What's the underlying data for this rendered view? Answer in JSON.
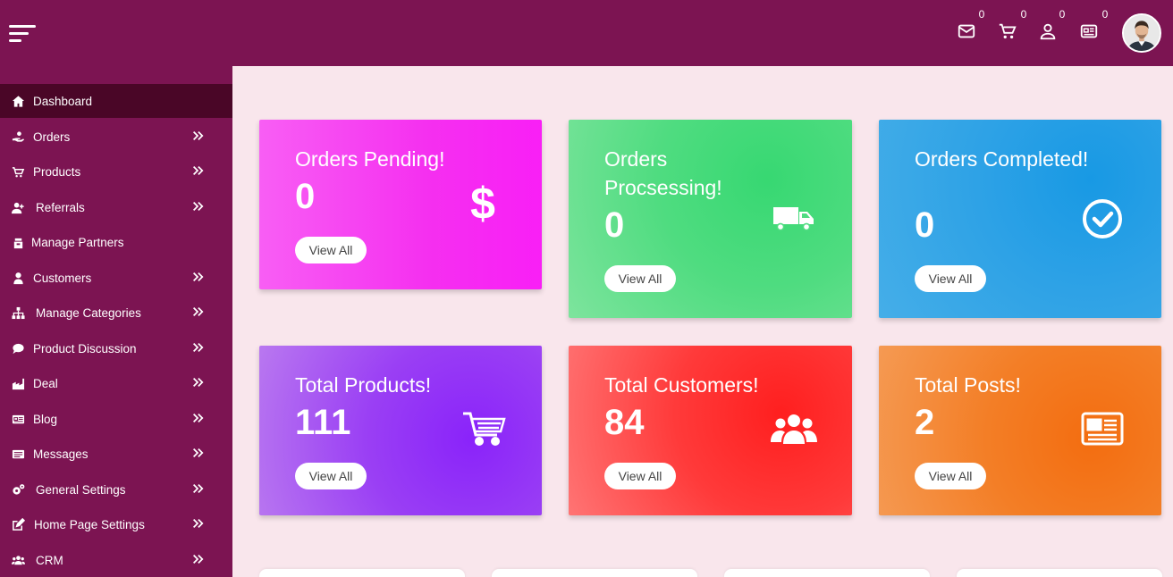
{
  "header": {
    "counts": {
      "messages": "0",
      "cart": "0",
      "users": "0",
      "news": "0"
    },
    "colors": {
      "bar": "#7c1452",
      "sidebar": "#7c1452",
      "sidebar_active": "#4a0627",
      "content": "#f9e6ec"
    }
  },
  "sidebar": {
    "items": [
      {
        "label": "Dashboard",
        "icon": "home-icon",
        "active": true,
        "has_submenu": false
      },
      {
        "label": "Orders",
        "icon": "hand-holding-icon",
        "active": false,
        "has_submenu": true
      },
      {
        "label": "Products",
        "icon": "cart-icon",
        "active": false,
        "has_submenu": true
      },
      {
        "label": "Referrals",
        "icon": "user-plus-icon",
        "active": false,
        "has_submenu": true
      },
      {
        "label": "Manage Partners",
        "icon": "partners-icon",
        "active": false,
        "has_submenu": false
      },
      {
        "label": "Customers",
        "icon": "user-icon",
        "active": false,
        "has_submenu": true
      },
      {
        "label": "Manage Categories",
        "icon": "sitemap-icon",
        "active": false,
        "has_submenu": true
      },
      {
        "label": "Product Discussion",
        "icon": "comment-icon",
        "active": false,
        "has_submenu": true
      },
      {
        "label": "Deal",
        "icon": "deal-icon",
        "active": false,
        "has_submenu": true
      },
      {
        "label": "Blog",
        "icon": "newspaper-icon",
        "active": false,
        "has_submenu": true
      },
      {
        "label": "Messages",
        "icon": "messages-icon",
        "active": false,
        "has_submenu": true
      },
      {
        "label": "General Settings",
        "icon": "cogs-icon",
        "active": false,
        "has_submenu": true
      },
      {
        "label": "Home Page Settings",
        "icon": "edit-icon",
        "active": false,
        "has_submenu": true
      },
      {
        "label": "CRM",
        "icon": "users-icon",
        "active": false,
        "has_submenu": true
      }
    ]
  },
  "cards": [
    {
      "title": "Orders Pending!",
      "value": "0",
      "button": "View All",
      "icon": "dollar-icon"
    },
    {
      "title": "Orders Procsessing!",
      "value": "0",
      "button": "View All",
      "icon": "truck-icon"
    },
    {
      "title": "Orders Completed!",
      "value": "0",
      "button": "View All",
      "icon": "check-circle-icon"
    },
    {
      "title": "Total Products!",
      "value": "111",
      "button": "View All",
      "icon": "cart-icon"
    },
    {
      "title": "Total Customers!",
      "value": "84",
      "button": "View All",
      "icon": "users-icon"
    },
    {
      "title": "Total Posts!",
      "value": "2",
      "button": "View All",
      "icon": "newspaper-icon"
    }
  ]
}
